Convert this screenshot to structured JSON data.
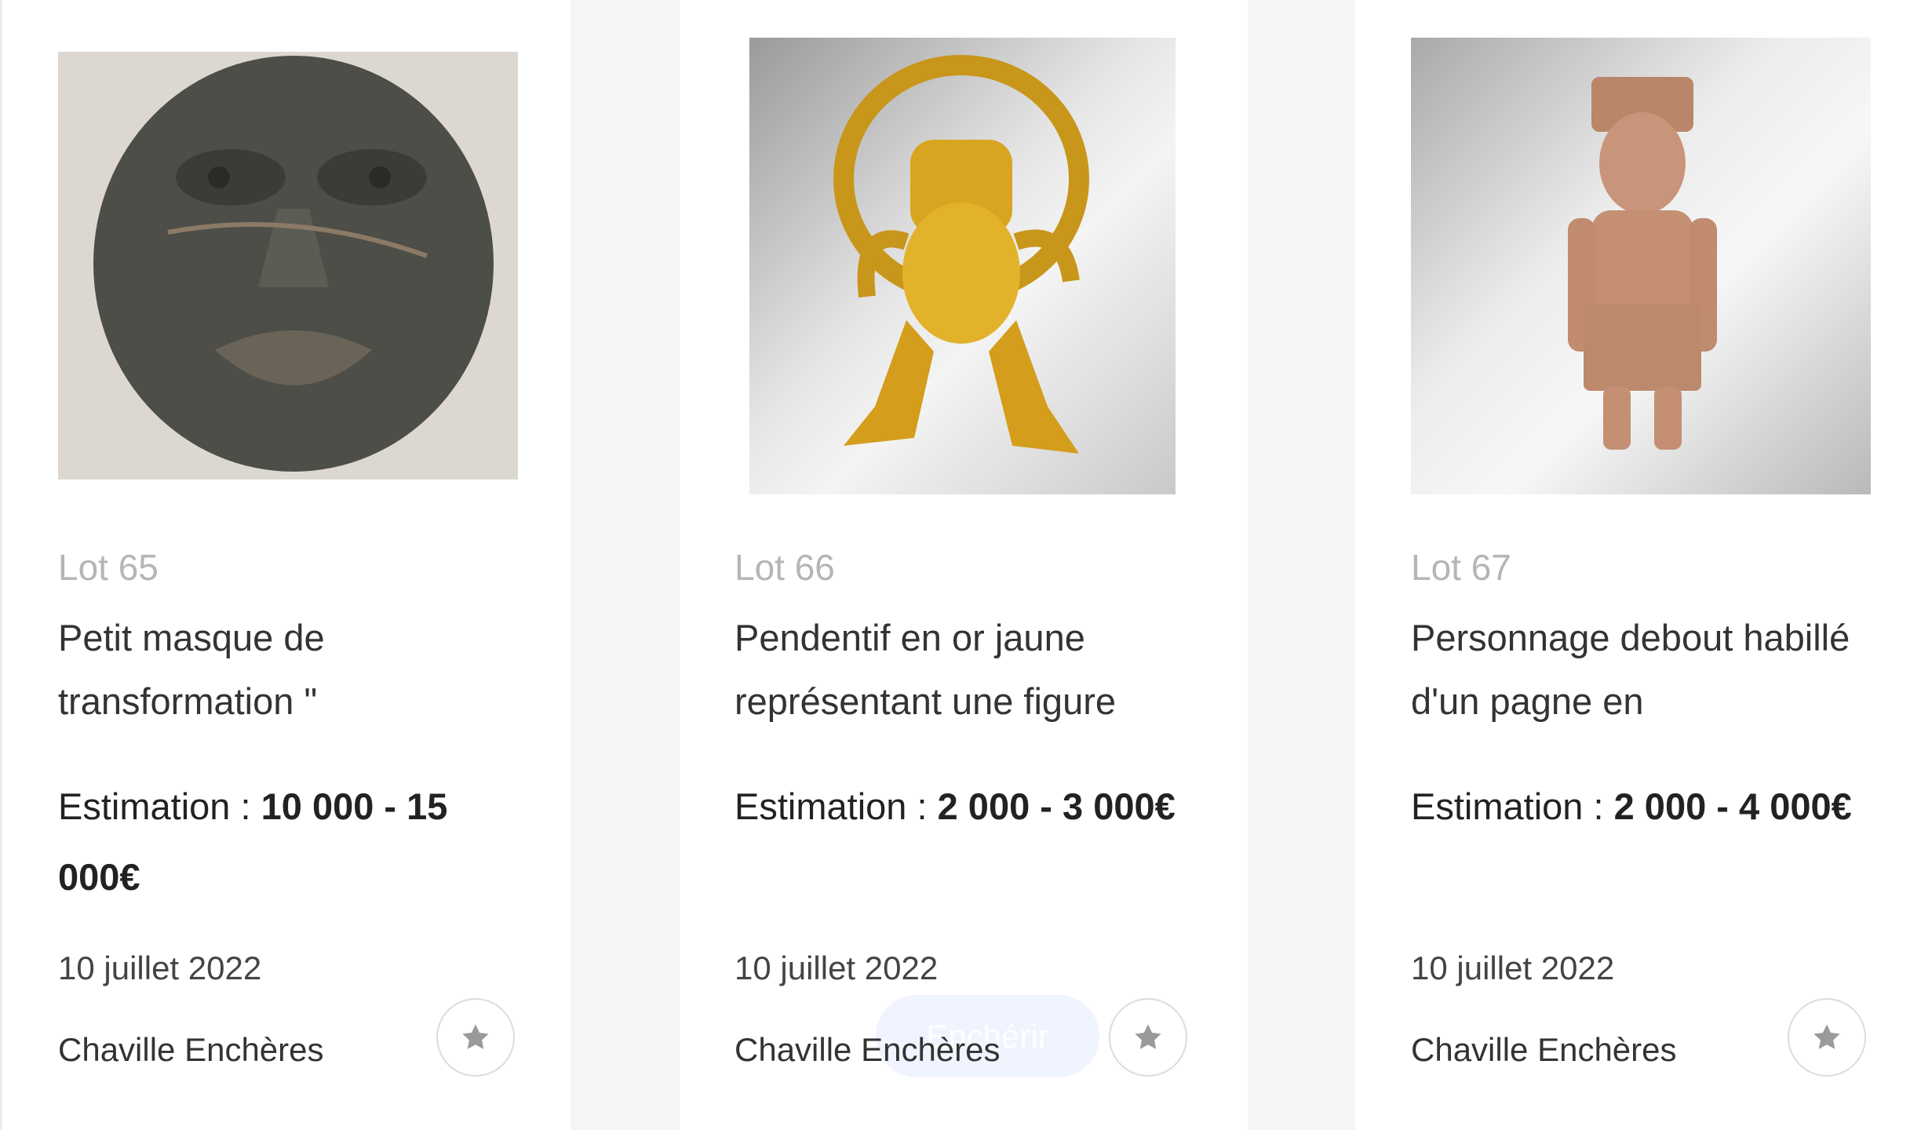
{
  "lots": [
    {
      "lot_label": "Lot 65",
      "title": "Petit masque de transformation \"",
      "estimate_label": "Estimation :",
      "estimate_value": "10 000 - 15 000€",
      "date": "10 juillet 2022",
      "auction_house": "Chaville Enchères",
      "favorite_icon": "star-icon"
    },
    {
      "lot_label": "Lot 66",
      "title": "Pendentif en or jaune représentant une figure",
      "estimate_label": "Estimation :",
      "estimate_value": "2 000 - 3 000€",
      "date": "10 juillet 2022",
      "auction_house": "Chaville Enchères",
      "bid_button_label": "Enchérir",
      "favorite_icon": "star-icon"
    },
    {
      "lot_label": "Lot 67",
      "title": "Personnage debout habillé d'un pagne en",
      "estimate_label": "Estimation :",
      "estimate_value": "2 000 - 4 000€",
      "date": "10 juillet 2022",
      "auction_house": "Chaville Enchères",
      "favorite_icon": "star-icon"
    }
  ],
  "colors": {
    "page_background": "#f5f5f6",
    "card_background": "#ffffff",
    "lot_number": "#b5b5b5",
    "text": "#333333",
    "star": "#9a9a9a"
  }
}
